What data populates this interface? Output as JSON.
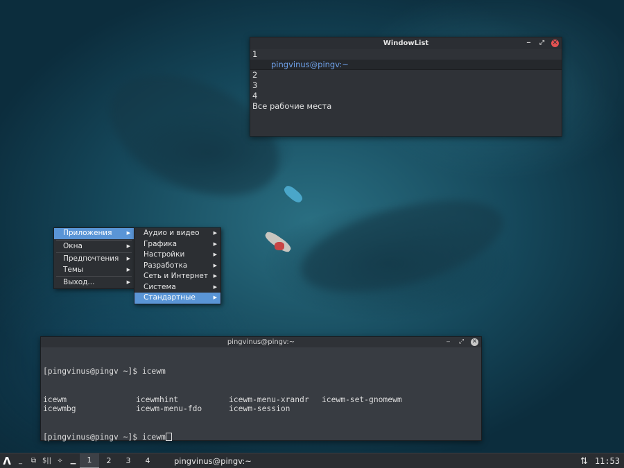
{
  "windowlist": {
    "title": "WindowList",
    "workspaces": [
      {
        "label": "1",
        "windows": [
          "pingvinus@pingv:~"
        ]
      },
      {
        "label": "2",
        "windows": []
      },
      {
        "label": "3",
        "windows": []
      },
      {
        "label": "4",
        "windows": []
      }
    ],
    "all_workspaces": "Все рабочие места",
    "buttons": {
      "minimize": "‒",
      "maximize": "⤢",
      "close": "✕"
    }
  },
  "start_menu": {
    "items": [
      {
        "label": "Приложения",
        "active": true
      },
      {
        "label": "Окна",
        "active": false
      },
      {
        "label": "Предпочтения",
        "active": false
      },
      {
        "label": "Темы",
        "active": false
      },
      {
        "label": "Выход...",
        "active": false
      }
    ],
    "submenu": [
      {
        "label": "Аудио и видео",
        "active": false
      },
      {
        "label": "Графика",
        "active": false
      },
      {
        "label": "Настройки",
        "active": false
      },
      {
        "label": "Разработка",
        "active": false
      },
      {
        "label": "Сеть и Интернет",
        "active": false
      },
      {
        "label": "Система",
        "active": false
      },
      {
        "label": "Стандартные",
        "active": true
      }
    ],
    "arrow": "▶"
  },
  "terminal": {
    "title": "pingvinus@pingv:~",
    "prompt": "[pingvinus@pingv ~]$ ",
    "command1": "icewm",
    "completions": [
      "icewm",
      "icewmhint",
      "icewm-menu-xrandr",
      "icewm-set-gnomewm",
      "icewmbg",
      "icewm-menu-fdo",
      "icewm-session",
      ""
    ],
    "command2": "icewm"
  },
  "taskbar": {
    "start_icon": "Λ",
    "icons": [
      "_",
      "⧉",
      "$||",
      "⟡",
      "▁"
    ],
    "workspaces": [
      "1",
      "2",
      "3",
      "4"
    ],
    "active_workspace": "1",
    "task": "pingvinus@pingv:~",
    "network_icon": "⇅",
    "clock": "11:53"
  },
  "colors": {
    "accent": "#5a95d6",
    "close": "#e35252",
    "window_bg": "#2f3237",
    "terminal_bg": "#383c42",
    "link_blue": "#6ea0e8"
  }
}
